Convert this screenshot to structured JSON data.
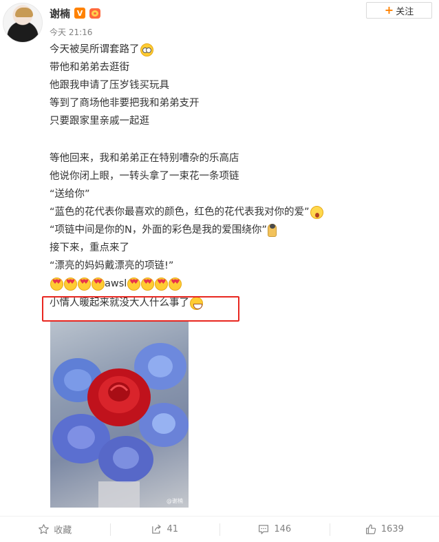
{
  "post": {
    "username": "谢楠",
    "verified_badge": "V",
    "time": "今天 21:16",
    "follow_label": "关注",
    "follow_icon": "plus-icon",
    "lines": [
      "今天被吴所谓套路了",
      "带他和弟弟去逛街",
      "他跟我申请了压岁钱买玩具",
      "等到了商场他非要把我和弟弟支开",
      "只要跟家里亲戚一起逛",
      "",
      "等他回来，我和弟弟正在特别嘈杂的乐高店",
      "他说你闭上眼，一转头拿了一束花一条项链",
      "“送给你”",
      "“蓝色的花代表你最喜欢的颜色，红色的花代表我对你的爱”",
      "“项链中间是你的N，外面的彩色是我的爱围绕你”",
      "接下来，重点来了",
      "“漂亮的妈妈戴漂亮的项链!”",
      "awsl",
      "小情人暖起来就没大人什么事了"
    ],
    "emoji_names": [
      "glasses-emoji",
      "shocked-emoji",
      "kneeling-emoji",
      "heart-eyes-emoji",
      "grin-emoji"
    ],
    "photo_watermark": "@谢楠",
    "highlight_color": "#e8261f",
    "accent_color": "#ff8200"
  },
  "actions": {
    "collect_label": "收藏",
    "repost_count": "41",
    "comment_count": "146",
    "like_count": "1639"
  }
}
